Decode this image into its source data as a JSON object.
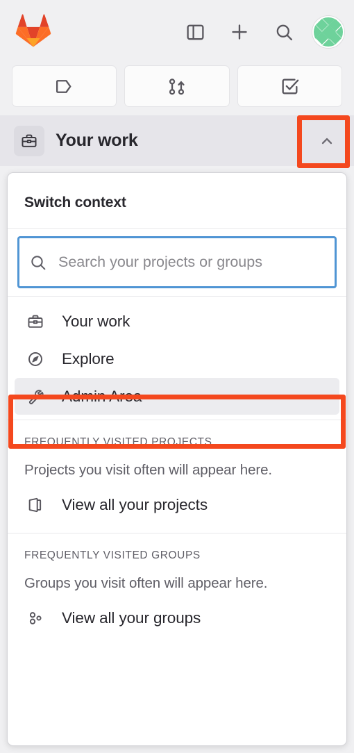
{
  "colors": {
    "annotation": "#f4481e",
    "focus_border": "#5095d4",
    "header_bg": "#e6e5ea",
    "page_bg": "#f0f0f2",
    "text": "#28272d",
    "muted_text": "#5f5e66",
    "logo_dark_orange": "#e24329",
    "logo_orange": "#fc6d26",
    "logo_light_orange": "#fca326",
    "avatar_green": "#6ed29b"
  },
  "topbar": {
    "logo_name": "gitlab-tanuki-logo",
    "actions": [
      {
        "name": "toggle-sidebar-button",
        "icon": "sidebar-panel-icon"
      },
      {
        "name": "create-new-button",
        "icon": "plus-icon"
      },
      {
        "name": "search-button",
        "icon": "search-icon"
      }
    ],
    "avatar_label": "user-avatar"
  },
  "quick_actions": [
    {
      "name": "issues-button",
      "icon": "issues-icon",
      "label": "Issues"
    },
    {
      "name": "merge-requests-button",
      "icon": "merge-request-icon",
      "label": "Merge requests"
    },
    {
      "name": "todos-button",
      "icon": "todo-checkbox-icon",
      "label": "To-Do List"
    }
  ],
  "context_header": {
    "icon": "briefcase-icon",
    "title": "Your work",
    "toggle_icon": "chevron-up-icon"
  },
  "dropdown": {
    "title": "Switch context",
    "search": {
      "placeholder": "Search your projects or groups",
      "value": "",
      "icon": "search-icon"
    },
    "items": [
      {
        "label": "Your work",
        "icon": "briefcase-icon",
        "active": false
      },
      {
        "label": "Explore",
        "icon": "compass-icon",
        "active": false
      },
      {
        "label": "Admin Area",
        "icon": "wrench-icon",
        "active": true
      }
    ],
    "projects_section": {
      "heading": "Frequently visited projects",
      "empty_text": "Projects you visit often will appear here.",
      "link_label": "View all your projects",
      "link_icon": "project-icon"
    },
    "groups_section": {
      "heading": "Frequently visited groups",
      "empty_text": "Groups you visit often will appear here.",
      "link_label": "View all your groups",
      "link_icon": "group-icon"
    }
  },
  "annotations": [
    {
      "name": "annotation-collapse-toggle",
      "target": "chevron-up-icon"
    },
    {
      "name": "annotation-admin-area",
      "target": "Admin Area"
    }
  ]
}
